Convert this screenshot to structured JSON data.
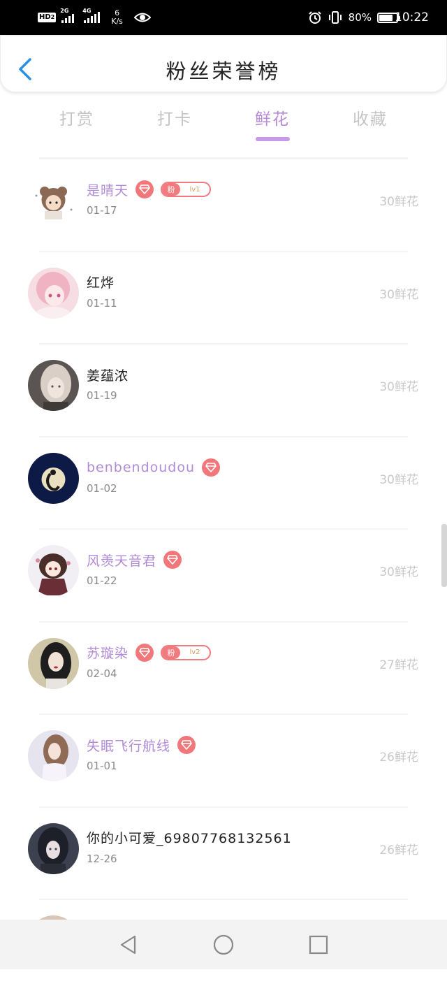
{
  "status_bar": {
    "hd": "HD",
    "hd_sub": "2",
    "net1": "2G",
    "net2": "4G",
    "speed_value": "6",
    "speed_unit": "K/s",
    "battery": "80%",
    "time": "10:22"
  },
  "header": {
    "title": "粉丝荣誉榜"
  },
  "tabs": [
    {
      "label": "打赏"
    },
    {
      "label": "打卡"
    },
    {
      "label": "鲜花",
      "active": true
    },
    {
      "label": "收藏"
    }
  ],
  "colors": {
    "accent": "#b88ad6",
    "vip_name": "#b28bd8",
    "badge": "#f2777b",
    "amount": "#c9c9c9"
  },
  "fans": [
    {
      "name": "是晴天",
      "date": "01-17",
      "amount": "30鲜花",
      "vip": true,
      "fan_badge": {
        "label": "粉",
        "level": "lv1"
      },
      "avatar_icon": "bear-hood-avatar"
    },
    {
      "name": "红烨",
      "date": "01-11",
      "amount": "30鲜花",
      "vip": false,
      "avatar_icon": "pink-anime-avatar"
    },
    {
      "name": "姜蕴浓",
      "date": "01-19",
      "amount": "30鲜花",
      "vip": false,
      "avatar_icon": "photo-girl-avatar"
    },
    {
      "name": "benbendoudou",
      "date": "01-02",
      "amount": "30鲜花",
      "vip": true,
      "avatar_icon": "moon-night-avatar"
    },
    {
      "name": "风羡天音君",
      "date": "01-22",
      "amount": "30鲜花",
      "vip": true,
      "avatar_icon": "chibi-anime-avatar"
    },
    {
      "name": "苏璇染",
      "date": "02-04",
      "amount": "27鲜花",
      "vip": true,
      "fan_badge": {
        "label": "粉",
        "level": "lv2"
      },
      "avatar_icon": "dark-hair-avatar"
    },
    {
      "name": "失眠飞行航线",
      "date": "01-01",
      "amount": "26鲜花",
      "vip": true,
      "avatar_icon": "soft-photo-avatar"
    },
    {
      "name": "你的小可爱_69807768132561",
      "date": "12-26",
      "amount": "26鲜花",
      "vip": false,
      "avatar_icon": "gothic-anime-avatar"
    }
  ]
}
